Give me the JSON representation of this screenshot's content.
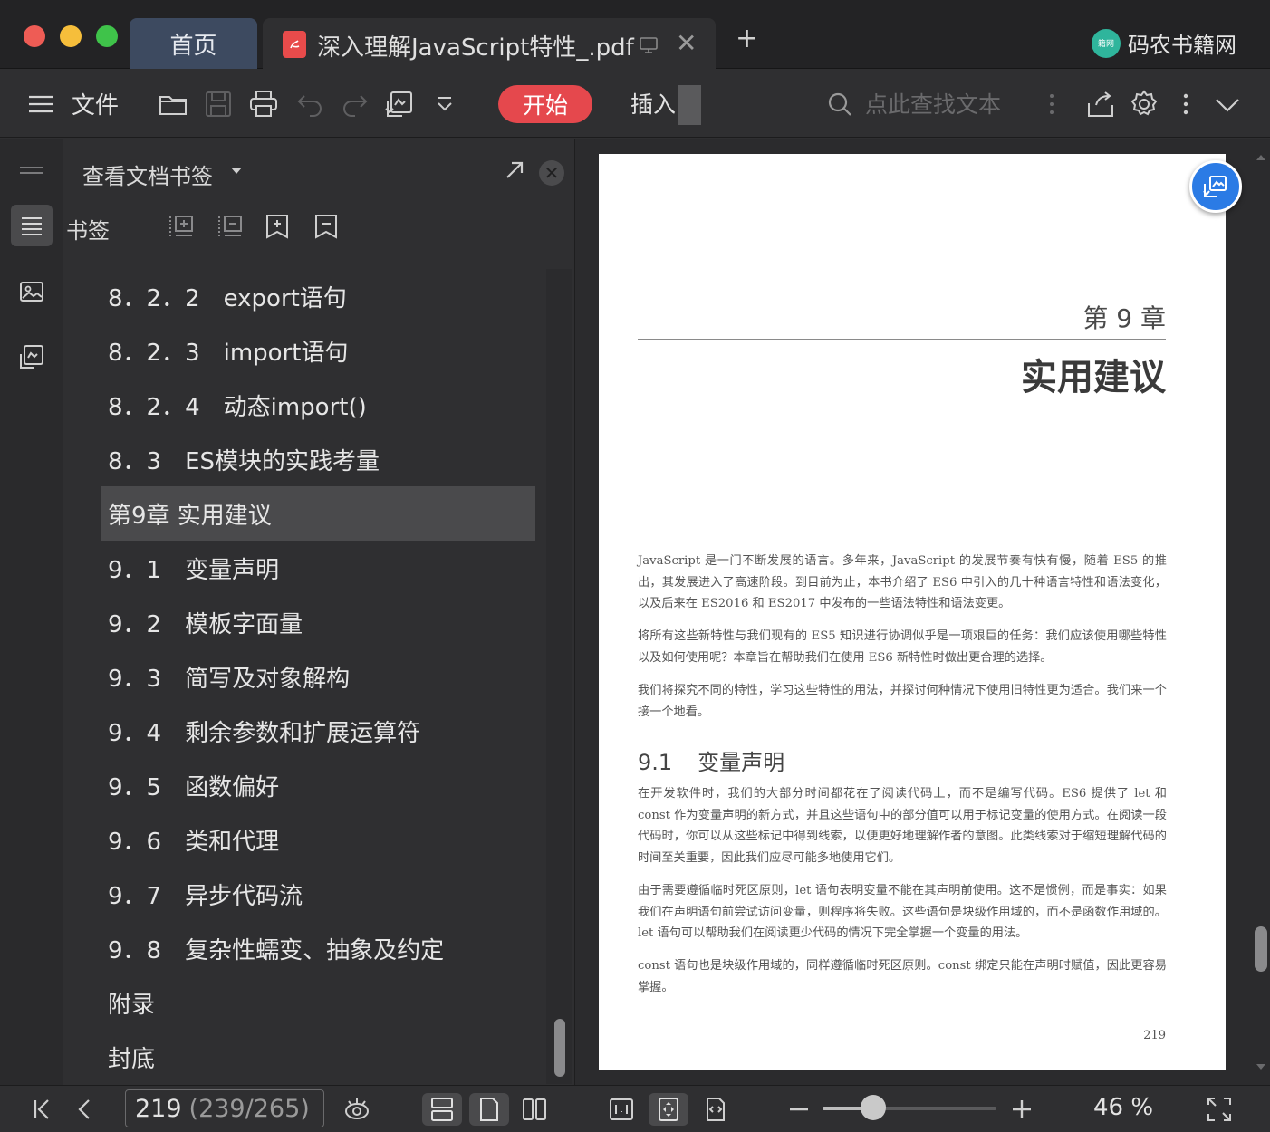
{
  "window": {
    "traffic_lights": {
      "close": "#ee5c55",
      "minimize": "#f6be3b",
      "maximize": "#3fc34a"
    }
  },
  "tabs": {
    "home_label": "首页",
    "document_label": "深入理解JavaScript特性_.pdf",
    "close_symbol": "✕",
    "new_tab_symbol": "+"
  },
  "brand": {
    "logo_text": "籍网",
    "name": "码农书籍网"
  },
  "toolbar": {
    "menu_file": "文件",
    "start_label": "开始",
    "insert_label": "插入",
    "search_placeholder": "点此查找文本",
    "accent": "#e5484d"
  },
  "bookmark_panel": {
    "title": "查看文档书签",
    "subtitle": "书签",
    "close_symbol": "✕",
    "selected_index": 4,
    "items": [
      "8．2．2　export语句",
      "8．2．3　import语句",
      "8．2．4　动态import()",
      "8．3　ES模块的实践考量",
      "第9章 实用建议",
      "9．1　变量声明",
      "9．2　模板字面量",
      "9．3　简写及对象解构",
      "9．4　剩余参数和扩展运算符",
      "9．5　函数偏好",
      "9．6　类和代理",
      "9．7　异步代码流",
      "9．8　复杂性蠕变、抽象及约定",
      "附录",
      "封底"
    ]
  },
  "document_page": {
    "chapter_number": "第 9 章",
    "chapter_title": "实用建议",
    "paragraphs": [
      "JavaScript 是一门不断发展的语言。多年来，JavaScript 的发展节奏有快有慢，随着 ES5 的推出，其发展进入了高速阶段。到目前为止，本书介绍了 ES6 中引入的几十种语言特性和语法变化，以及后来在 ES2016 和 ES2017 中发布的一些语法特性和语法变更。",
      "将所有这些新特性与我们现有的 ES5 知识进行协调似乎是一项艰巨的任务：我们应该使用哪些特性以及如何使用呢？本章旨在帮助我们在使用 ES6 新特性时做出更合理的选择。",
      "我们将探究不同的特性，学习这些特性的用法，并探讨何种情况下使用旧特性更为适合。我们来一个接一个地看。"
    ],
    "section_number": "9.1",
    "section_title": "变量声明",
    "section_paragraphs": [
      "在开发软件时，我们的大部分时间都花在了阅读代码上，而不是编写代码。ES6 提供了 let 和 const 作为变量声明的新方式，并且这些语句中的部分值可以用于标记变量的使用方式。在阅读一段代码时，你可以从这些标记中得到线索，以便更好地理解作者的意图。此类线索对于缩短理解代码的时间至关重要，因此我们应尽可能多地使用它们。",
      "由于需要遵循临时死区原则，let 语句表明变量不能在其声明前使用。这不是惯例，而是事实：如果我们在声明语句前尝试访问变量，则程序将失败。这些语句是块级作用域的，而不是函数作用域的。let 语句可以帮助我们在阅读更少代码的情况下完全掌握一个变量的用法。",
      "const 语句也是块级作用域的，同样遵循临时死区原则。const 绑定只能在声明时赋值，因此更容易掌握。"
    ],
    "page_number": "219"
  },
  "statusbar": {
    "current_page": "219",
    "page_total": "(239/265)",
    "zoom_percent": "46 %",
    "zoom_fraction": 0.29
  }
}
